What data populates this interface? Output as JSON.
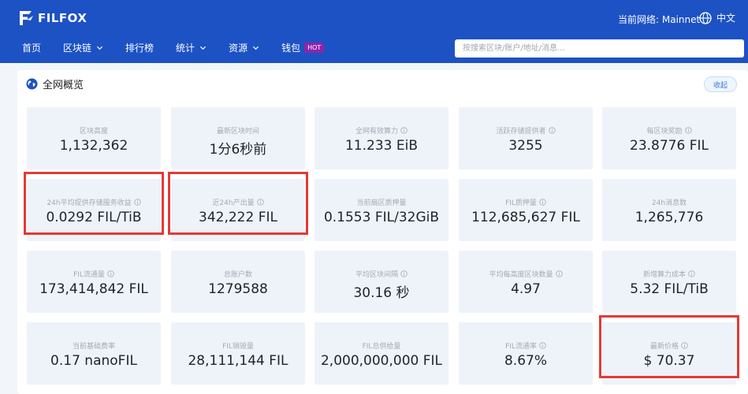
{
  "brand": {
    "name": "FILFOX"
  },
  "header": {
    "network_label": "当前网络: Mainnet",
    "language": "中文",
    "nav": [
      {
        "label": "首页",
        "dropdown": false,
        "badge": ""
      },
      {
        "label": "区块链",
        "dropdown": true,
        "badge": ""
      },
      {
        "label": "排行榜",
        "dropdown": false,
        "badge": ""
      },
      {
        "label": "统计",
        "dropdown": true,
        "badge": ""
      },
      {
        "label": "资源",
        "dropdown": true,
        "badge": ""
      },
      {
        "label": "钱包",
        "dropdown": false,
        "badge": "HOT"
      }
    ],
    "search_placeholder": "按搜索区块/账户/地址/消息..."
  },
  "overview": {
    "title": "全网概览",
    "collapse_label": "收起",
    "stats": [
      {
        "label": "区块高度",
        "value": "1,132,362",
        "info": false,
        "highlight": false
      },
      {
        "label": "最新区块时间",
        "value": "1分6秒前",
        "info": false,
        "highlight": false
      },
      {
        "label": "全网有效算力",
        "value": "11.233 EiB",
        "info": true,
        "highlight": false
      },
      {
        "label": "活跃存储提供者",
        "value": "3255",
        "info": true,
        "highlight": false
      },
      {
        "label": "每区块奖励",
        "value": "23.8776 FIL",
        "info": true,
        "highlight": false
      },
      {
        "label": "24h平均提供存储服务收益",
        "value": "0.0292 FIL/TiB",
        "info": true,
        "highlight": true
      },
      {
        "label": "近24h产出量",
        "value": "342,222 FIL",
        "info": true,
        "highlight": true
      },
      {
        "label": "当前扇区质押量",
        "value": "0.1553 FIL/32GiB",
        "info": false,
        "highlight": false
      },
      {
        "label": "FIL质押量",
        "value": "112,685,627 FIL",
        "info": true,
        "highlight": false
      },
      {
        "label": "24h消息数",
        "value": "1,265,776",
        "info": false,
        "highlight": false
      },
      {
        "label": "FIL流通量",
        "value": "173,414,842 FIL",
        "info": true,
        "highlight": false
      },
      {
        "label": "总账户数",
        "value": "1279588",
        "info": false,
        "highlight": false
      },
      {
        "label": "平均区块间隔",
        "value": "30.16 秒",
        "info": true,
        "highlight": false
      },
      {
        "label": "平均每高度区块数量",
        "value": "4.97",
        "info": true,
        "highlight": false
      },
      {
        "label": "新增算力成本",
        "value": "5.32 FIL/TiB",
        "info": true,
        "highlight": false
      },
      {
        "label": "当前基础费率",
        "value": "0.17 nanoFIL",
        "info": false,
        "highlight": false
      },
      {
        "label": "FIL销毁量",
        "value": "28,111,144 FIL",
        "info": false,
        "highlight": false
      },
      {
        "label": "FIL总供给量",
        "value": "2,000,000,000 FIL",
        "info": false,
        "highlight": false
      },
      {
        "label": "FIL流通率",
        "value": "8.67%",
        "info": true,
        "highlight": false
      },
      {
        "label": "最新价格",
        "value": "$ 70.37",
        "info": true,
        "highlight": true
      }
    ]
  },
  "colors": {
    "header_bg": "#1d52c4",
    "tile_bg": "#eef3f9",
    "highlight_border": "#e53935",
    "hot_badge": "#8e24aa"
  }
}
